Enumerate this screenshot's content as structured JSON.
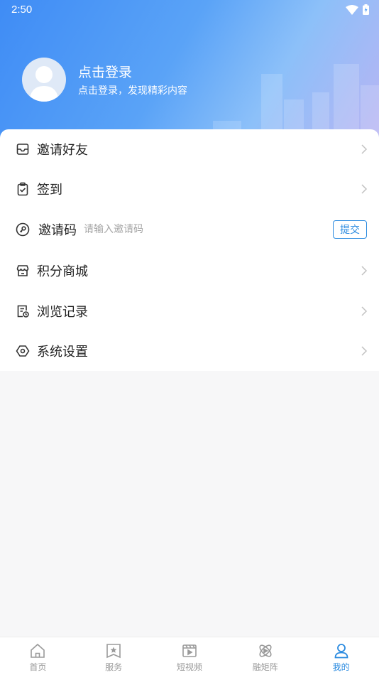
{
  "status_bar": {
    "time": "2:50"
  },
  "profile": {
    "title": "点击登录",
    "subtitle": "点击登录，发现精彩内容"
  },
  "menu": {
    "invite_friends": "邀请好友",
    "sign_in": "签到",
    "invite_code_label": "邀请码",
    "invite_code_placeholder": "请输入邀请码",
    "submit": "提交",
    "points_mall": "积分商城",
    "history": "浏览记录",
    "settings": "系统设置"
  },
  "tabs": [
    {
      "label": "首页",
      "icon": "home-icon"
    },
    {
      "label": "服务",
      "icon": "service-star-icon"
    },
    {
      "label": "短视频",
      "icon": "video-clapper-icon"
    },
    {
      "label": "融矩阵",
      "icon": "matrix-orbit-icon"
    },
    {
      "label": "我的",
      "icon": "user-icon",
      "active": true
    }
  ],
  "colors": {
    "accent": "#2b8be0",
    "header_start": "#3f8cf5",
    "header_end": "#b9b4f3"
  }
}
